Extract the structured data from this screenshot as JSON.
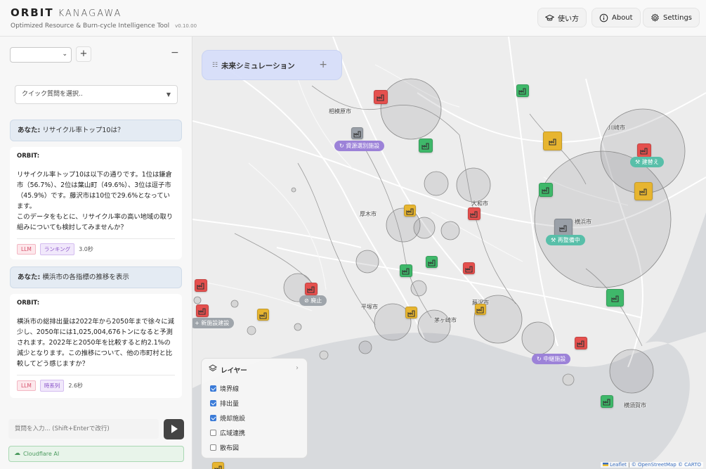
{
  "header": {
    "brand_bold": "ORBIT",
    "brand_light": "KANAGAWA",
    "subtitle": "Optimized Resource & Burn-cycle Intelligence Tool",
    "version": "v0.10.00",
    "buttons": {
      "howto": "使い方",
      "about": "About",
      "settings": "Settings"
    }
  },
  "sidebar": {
    "quick_placeholder": "クイック質問を選択..",
    "messages": [
      {
        "role": "user",
        "prefix": "あなた:",
        "text": "リサイクル率トップ10は？"
      },
      {
        "role": "bot",
        "name": "ORBIT:",
        "text": "リサイクル率トップ10は以下の通りです。1位は鎌倉市（56.7%）、2位は葉山町（49.6%）、3位は逗子市（45.9%）です。藤沢市は10位で29.6%となっています。\nこのデータをもとに、リサイクル率の高い地域の取り組みについても検討してみませんか？",
        "tag_llm": "LLM",
        "tag_kind": "ランキング",
        "time": "3.0秒"
      },
      {
        "role": "user",
        "prefix": "あなた:",
        "text": "横浜市の各指標の推移を表示"
      },
      {
        "role": "bot",
        "name": "ORBIT:",
        "text": "横浜市の総排出量は2022年から2050年まで徐々に減少し、2050年には1,025,004,676トンになると予測されます。2022年と2050年を比較すると約2.1%の減少となります。この推移について、他の市町村と比較してどう感じますか？",
        "tag_llm": "LLM",
        "tag_kind": "時系列",
        "time": "2.6秒"
      }
    ],
    "input_placeholder": "質問を入力... (Shift+Enterで改行)",
    "cloudflare": "Cloudflare AI"
  },
  "map": {
    "simulation_label": "未来シミュレーション",
    "cities": [
      "相模原市",
      "川崎市",
      "大和市",
      "厚木市",
      "横浜市",
      "平塚市",
      "藤沢市",
      "茅ヶ崎市",
      "横須賀市"
    ],
    "badges": {
      "sorting": "資源選別施設",
      "rebuild": "建替え",
      "maintenance": "再整備中",
      "abolish": "廃止",
      "new_facility": "新施設建設",
      "relay": "中継施設"
    },
    "layers": {
      "title": "レイヤー",
      "items": [
        {
          "label": "境界線",
          "checked": true
        },
        {
          "label": "排出量",
          "checked": true
        },
        {
          "label": "焼却施設",
          "checked": true
        },
        {
          "label": "広域連携",
          "checked": false
        },
        {
          "label": "散布図",
          "checked": false
        }
      ]
    },
    "attribution": {
      "leaflet": "Leaflet",
      "osm": "© OpenStreetMap",
      "carto": "© CARTO"
    }
  },
  "colors": {
    "red": "#e5504e",
    "green": "#3fb86a",
    "yellow": "#e7b530",
    "gray": "#9aa0a8",
    "accent": "#3b7bd8"
  }
}
